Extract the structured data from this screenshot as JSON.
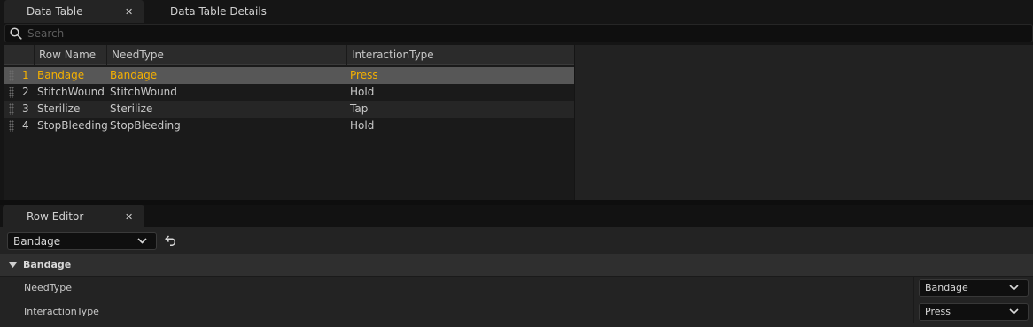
{
  "tabs": {
    "data_table": "Data Table",
    "data_table_details": "Data Table Details",
    "close_glyph": "✕"
  },
  "search": {
    "placeholder": "Search"
  },
  "table": {
    "columns": [
      "Row Name",
      "NeedType",
      "InteractionType"
    ],
    "rows": [
      {
        "index": "1",
        "row_name": "Bandage",
        "need_type": "Bandage",
        "interaction_type": "Press",
        "selected": true
      },
      {
        "index": "2",
        "row_name": "StitchWound",
        "need_type": "StitchWound",
        "interaction_type": "Hold",
        "selected": false
      },
      {
        "index": "3",
        "row_name": "Sterilize",
        "need_type": "Sterilize",
        "interaction_type": "Tap",
        "selected": false
      },
      {
        "index": "4",
        "row_name": "StopBleeding",
        "need_type": "StopBleeding",
        "interaction_type": "Hold",
        "selected": false
      }
    ]
  },
  "row_editor": {
    "tab_label": "Row Editor",
    "selected_row": "Bandage",
    "category": "Bandage",
    "properties": [
      {
        "name": "NeedType",
        "value": "Bandage"
      },
      {
        "name": "InteractionType",
        "value": "Press"
      }
    ]
  },
  "colors": {
    "selected_text": "#f6b100",
    "selected_row_bg": "#575757",
    "background": "#151515"
  }
}
